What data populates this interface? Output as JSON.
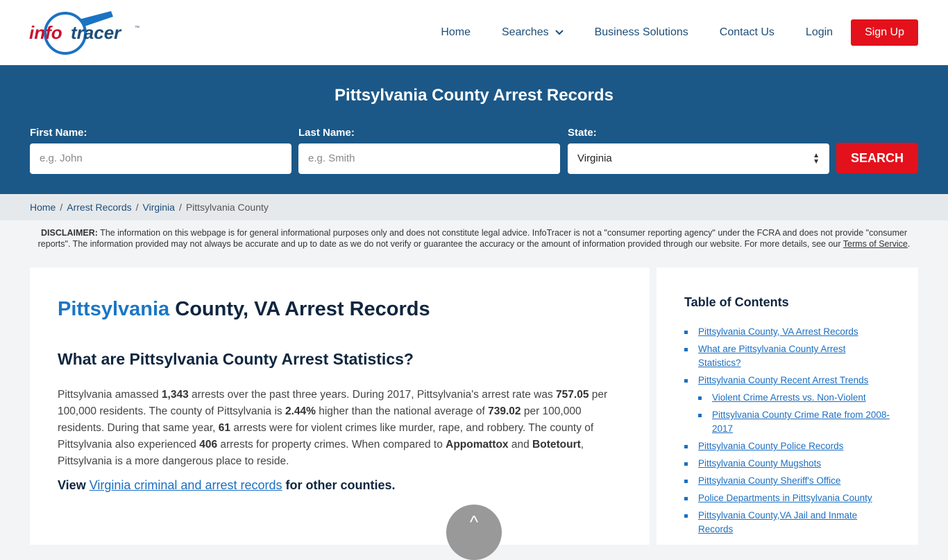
{
  "brand": {
    "name_part1": "info",
    "name_part2": "tracer",
    "tm": "™",
    "colors": {
      "red": "#c8102e",
      "blue": "#1b73c3"
    }
  },
  "nav": {
    "items": [
      "Home",
      "Searches",
      "Business Solutions",
      "Contact Us",
      "Login"
    ],
    "signup": "Sign Up"
  },
  "search": {
    "title": "Pittsylvania County Arrest Records",
    "first_label": "First Name:",
    "first_placeholder": "e.g. John",
    "last_label": "Last Name:",
    "last_placeholder": "e.g. Smith",
    "state_label": "State:",
    "state_value": "Virginia",
    "button": "SEARCH"
  },
  "breadcrumb": [
    "Home",
    "Arrest Records",
    "Virginia",
    "Pittsylvania County"
  ],
  "disclaimer": {
    "label": "DISCLAIMER:",
    "text": " The information on this webpage is for general informational purposes only and does not constitute legal advice. InfoTracer is not a \"consumer reporting agency\" under the FCRA and does not provide \"consumer reports\". The information provided may not always be accurate and up to date as we do not verify or guarantee the accuracy or the amount of information provided through our website. For more details, see our ",
    "link": "Terms of Service",
    "end": "."
  },
  "article": {
    "title_highlight": "Pittsylvania",
    "title_rest": " County, VA Arrest Records",
    "subtitle": "What are Pittsylvania County Arrest Statistics?",
    "p": [
      "Pittsylvania amassed ",
      "1,343",
      " arrests over the past three years. During 2017, Pittsylvania's arrest rate was ",
      "757.05",
      " per 100,000 residents. The county of Pittsylvania is ",
      "2.44%",
      " higher than the national average of ",
      "739.02",
      " per 100,000 residents. During that same year, ",
      "61",
      " arrests were for violent crimes like murder, rape, and robbery. The county of Pittsylvania also experienced ",
      "406",
      " arrests for property crimes. When compared to ",
      "Appomattox",
      " and ",
      "Botetourt",
      ", Pittsylvania is a more dangerous place to reside."
    ],
    "view_pre": "View ",
    "view_link": "Virginia criminal and arrest records",
    "view_post": " for other counties."
  },
  "toc": {
    "title": "Table of Contents",
    "items": [
      {
        "label": "Pittsylvania County, VA Arrest Records",
        "sub": false
      },
      {
        "label": "What are Pittsylvania County Arrest Statistics?",
        "sub": false
      },
      {
        "label": "Pittsylvania County Recent Arrest Trends",
        "sub": false
      },
      {
        "label": "Violent Crime Arrests vs. Non-Violent",
        "sub": true
      },
      {
        "label": "Pittsylvania County Crime Rate from 2008-2017",
        "sub": true
      },
      {
        "label": "Pittsylvania County Police Records",
        "sub": false
      },
      {
        "label": "Pittsylvania County Mugshots",
        "sub": false
      },
      {
        "label": "Pittsylvania County Sheriff's Office",
        "sub": false
      },
      {
        "label": "Police Departments in Pittsylvania County",
        "sub": false
      },
      {
        "label": "Pittsylvania County,VA Jail and Inmate Records",
        "sub": false
      }
    ]
  },
  "scroll_top": "^"
}
